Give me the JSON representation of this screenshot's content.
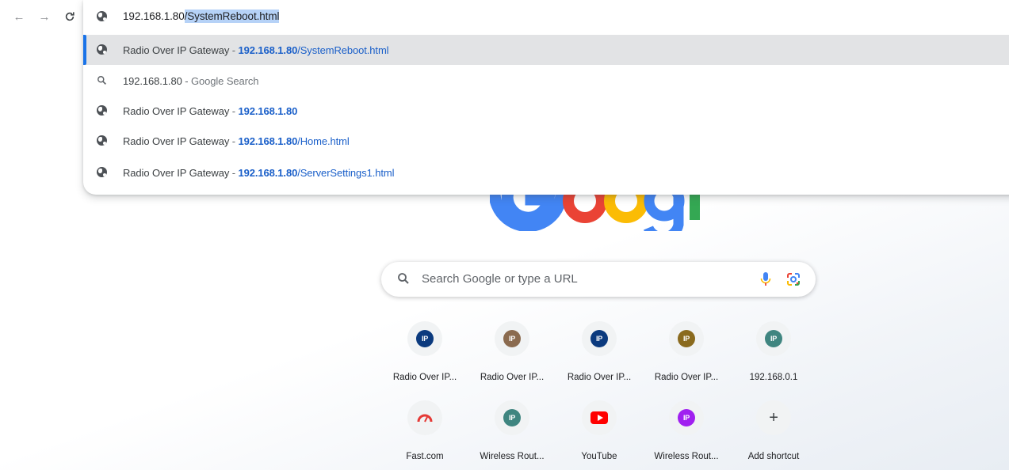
{
  "toolbar": {
    "back_glyph": "←",
    "forward_glyph": "→",
    "reload_glyph": "C"
  },
  "omnibox": {
    "url_host": "192.168.1.80",
    "url_path_selected": "/SystemReboot.html",
    "suggestions": [
      {
        "type": "history",
        "icon": "globe-icon",
        "title": "Radio Over IP Gateway",
        "sep": " - ",
        "host": "192.168.1.80",
        "path": "/SystemReboot.html",
        "hint": ""
      },
      {
        "type": "search",
        "icon": "search-icon",
        "title": "192.168.1.80",
        "sep": " - ",
        "host": "",
        "path": "",
        "hint": "Google Search"
      },
      {
        "type": "history",
        "icon": "globe-icon",
        "title": "Radio Over IP Gateway",
        "sep": " - ",
        "host": "192.168.1.80",
        "path": "",
        "hint": ""
      },
      {
        "type": "history",
        "icon": "globe-icon",
        "title": "Radio Over IP Gateway",
        "sep": " - ",
        "host": "192.168.1.80",
        "path": "/Home.html",
        "hint": ""
      },
      {
        "type": "history",
        "icon": "globe-icon",
        "title": "Radio Over IP Gateway",
        "sep": " - ",
        "host": "192.168.1.80",
        "path": "/ServerSettings1.html",
        "hint": ""
      }
    ],
    "selected_index": 0
  },
  "search": {
    "placeholder": "Search Google or type a URL"
  },
  "shortcuts": [
    {
      "label": "Radio Over IP...",
      "favicon": "IP",
      "color": "#0b3a7e"
    },
    {
      "label": "Radio Over IP...",
      "favicon": "IP",
      "color": "#8b6b4f"
    },
    {
      "label": "Radio Over IP...",
      "favicon": "IP",
      "color": "#0b3a7e"
    },
    {
      "label": "Radio Over IP...",
      "favicon": "IP",
      "color": "#8a6a1e"
    },
    {
      "label": "192.168.0.1",
      "favicon": "IP",
      "color": "#3f8580"
    },
    {
      "label": "Fast.com",
      "favicon": "speedometer",
      "color": "#e53935"
    },
    {
      "label": "Wireless Rout...",
      "favicon": "IP",
      "color": "#3f8580"
    },
    {
      "label": "YouTube",
      "favicon": "youtube",
      "color": "#ff0000"
    },
    {
      "label": "Wireless Rout...",
      "favicon": "IP",
      "color": "#a020f0"
    },
    {
      "label": "Add shortcut",
      "favicon": "+",
      "color": "#3c4043"
    }
  ]
}
